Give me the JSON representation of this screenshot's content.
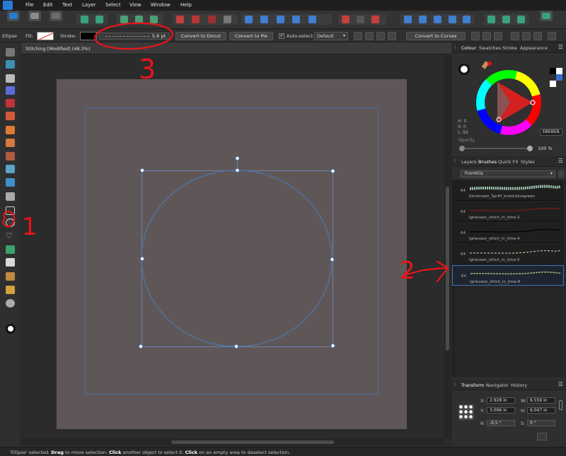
{
  "menu": {
    "items": [
      "File",
      "Edit",
      "Text",
      "Layer",
      "Select",
      "View",
      "Window",
      "Help"
    ]
  },
  "context": {
    "tool_name": "Ellipse",
    "fill_label": "Fill:",
    "stroke_label": "Stroke:",
    "stroke_width": "5.6 pt",
    "convert_donut": "Convert to Donut",
    "convert_pie": "Convert to Pie",
    "autoselect_label": "Auto-select:",
    "autoselect_value": "Default",
    "convert_curves": "Convert to Curves"
  },
  "document": {
    "tab_title": "Stitching [Modified] (48.3%)"
  },
  "colour_panel": {
    "tabs": [
      "Colour",
      "Swatches",
      "Stroke",
      "Appearance"
    ],
    "h": "H: 0",
    "s": "S: 0",
    "l": "L: 92",
    "hex": "EBEBEB",
    "opacity_label": "Opacity",
    "opacity_value": "100 %"
  },
  "brushes_panel": {
    "tabs": [
      "Layers",
      "Brushes",
      "Quick FX",
      "Styles"
    ],
    "category": "FromKits",
    "items": [
      {
        "num": "64",
        "name": "Kimlensen_Spritf_braid-bluegreen",
        "color": "#9ec4ae"
      },
      {
        "num": "64",
        "name": "lgrlevasn_stitch_in_time-2",
        "color": "#4a1414"
      },
      {
        "num": "64",
        "name": "lgrlevasn_stitch_in_time-4",
        "color": "#0e0e0e"
      },
      {
        "num": "64",
        "name": "lgrlevasn_stitch_in_time-5",
        "color": "#b7c3a2"
      },
      {
        "num": "64",
        "name": "lgrlevasn_stitch_in_time-6",
        "color": "#a8b07a"
      }
    ]
  },
  "transform_panel": {
    "tabs": [
      "Transform",
      "Navigator",
      "History"
    ],
    "x_label": "X:",
    "x": "2.928 in",
    "y_label": "Y:",
    "y": "3.096 in",
    "w_label": "W:",
    "w": "6.559 in",
    "h_label": "H:",
    "h": "6.047 in",
    "r_label": "R:",
    "r": "-0.5 °",
    "s_label": "S:",
    "s": "0 °"
  },
  "status": {
    "selected": "'Ellipse' selected.",
    "drag": "Drag",
    "t1": " to move selection. ",
    "click1": "Click",
    "t2": " another object to select it. ",
    "click2": "Click",
    "t3": " on an empty area to deselect selection."
  },
  "annotations": {
    "one": "1",
    "two": "2",
    "three": "3",
    "color": "#e8141c"
  }
}
